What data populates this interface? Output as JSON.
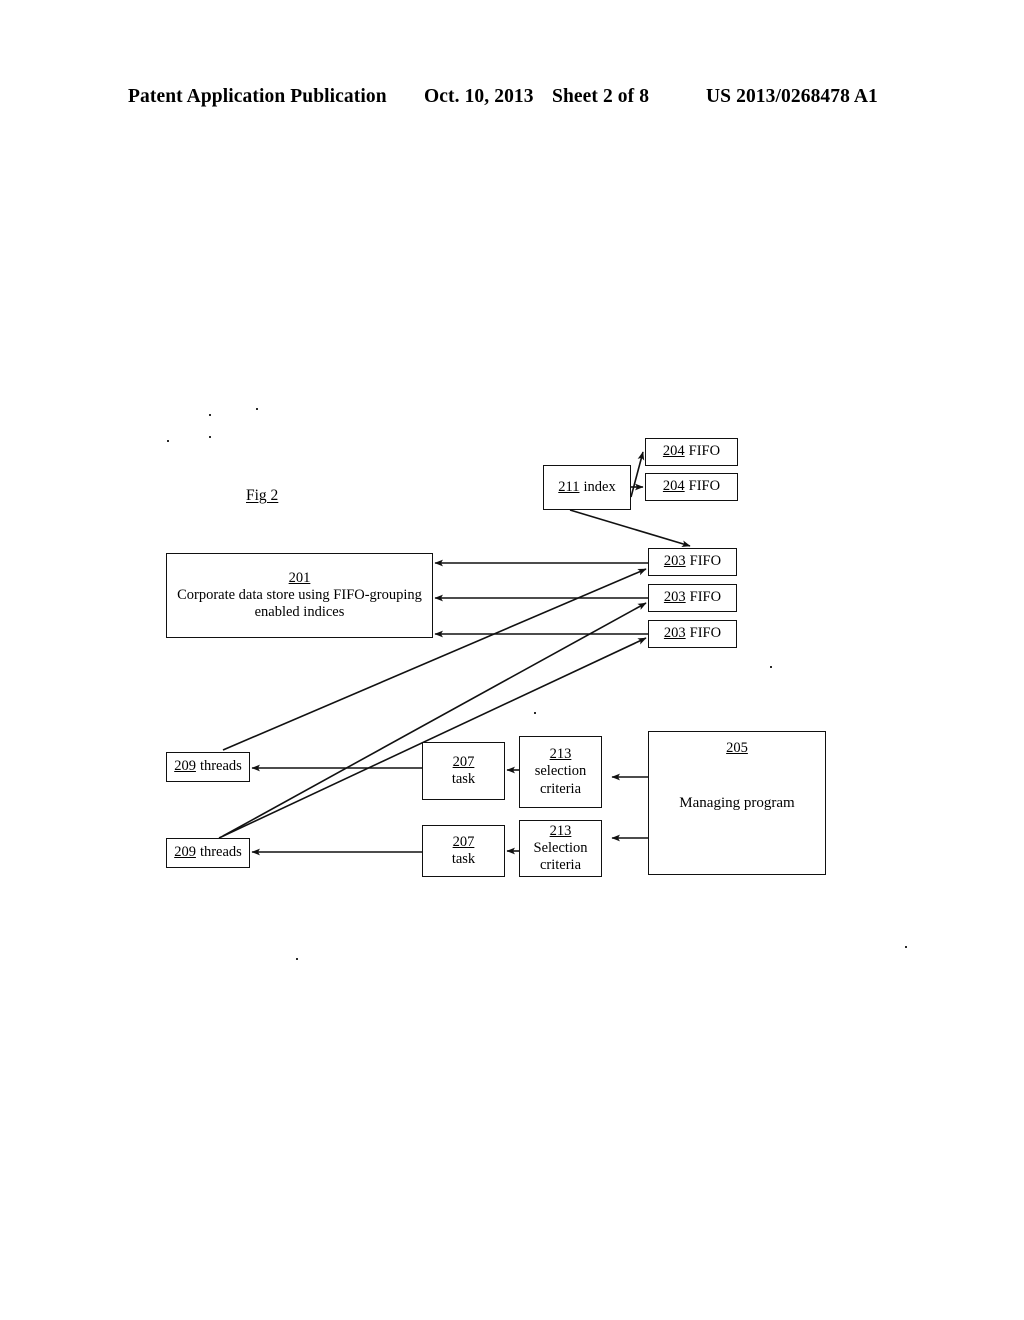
{
  "header": {
    "publication": "Patent Application Publication",
    "date": "Oct. 10, 2013",
    "sheet": "Sheet 2 of 8",
    "patent_number": "US 2013/0268478 A1"
  },
  "figure": {
    "label": "Fig 2",
    "boxes": {
      "index": {
        "ref": "211",
        "label": "index"
      },
      "fifo_204_1": {
        "ref": "204",
        "label": "FIFO"
      },
      "fifo_204_2": {
        "ref": "204",
        "label": "FIFO"
      },
      "datastore": {
        "ref": "201",
        "line1": "Corporate data store using FIFO-grouping",
        "line2": "enabled indices"
      },
      "fifo_203_1": {
        "ref": "203",
        "label": "FIFO"
      },
      "fifo_203_2": {
        "ref": "203",
        "label": "FIFO"
      },
      "fifo_203_3": {
        "ref": "203",
        "label": "FIFO"
      },
      "threads_1": {
        "ref": "209",
        "label": "threads"
      },
      "threads_2": {
        "ref": "209",
        "label": "threads"
      },
      "task_1": {
        "ref": "207",
        "label": "task"
      },
      "task_2": {
        "ref": "207",
        "label": "task"
      },
      "criteria_1": {
        "ref": "213",
        "line1": "selection",
        "line2": "criteria"
      },
      "criteria_2": {
        "ref": "213",
        "line1": "Selection",
        "line2": "criteria"
      },
      "managing": {
        "ref": "205",
        "label": "Managing program"
      }
    }
  },
  "colors": {
    "ink": "#111111",
    "page": "#ffffff"
  }
}
